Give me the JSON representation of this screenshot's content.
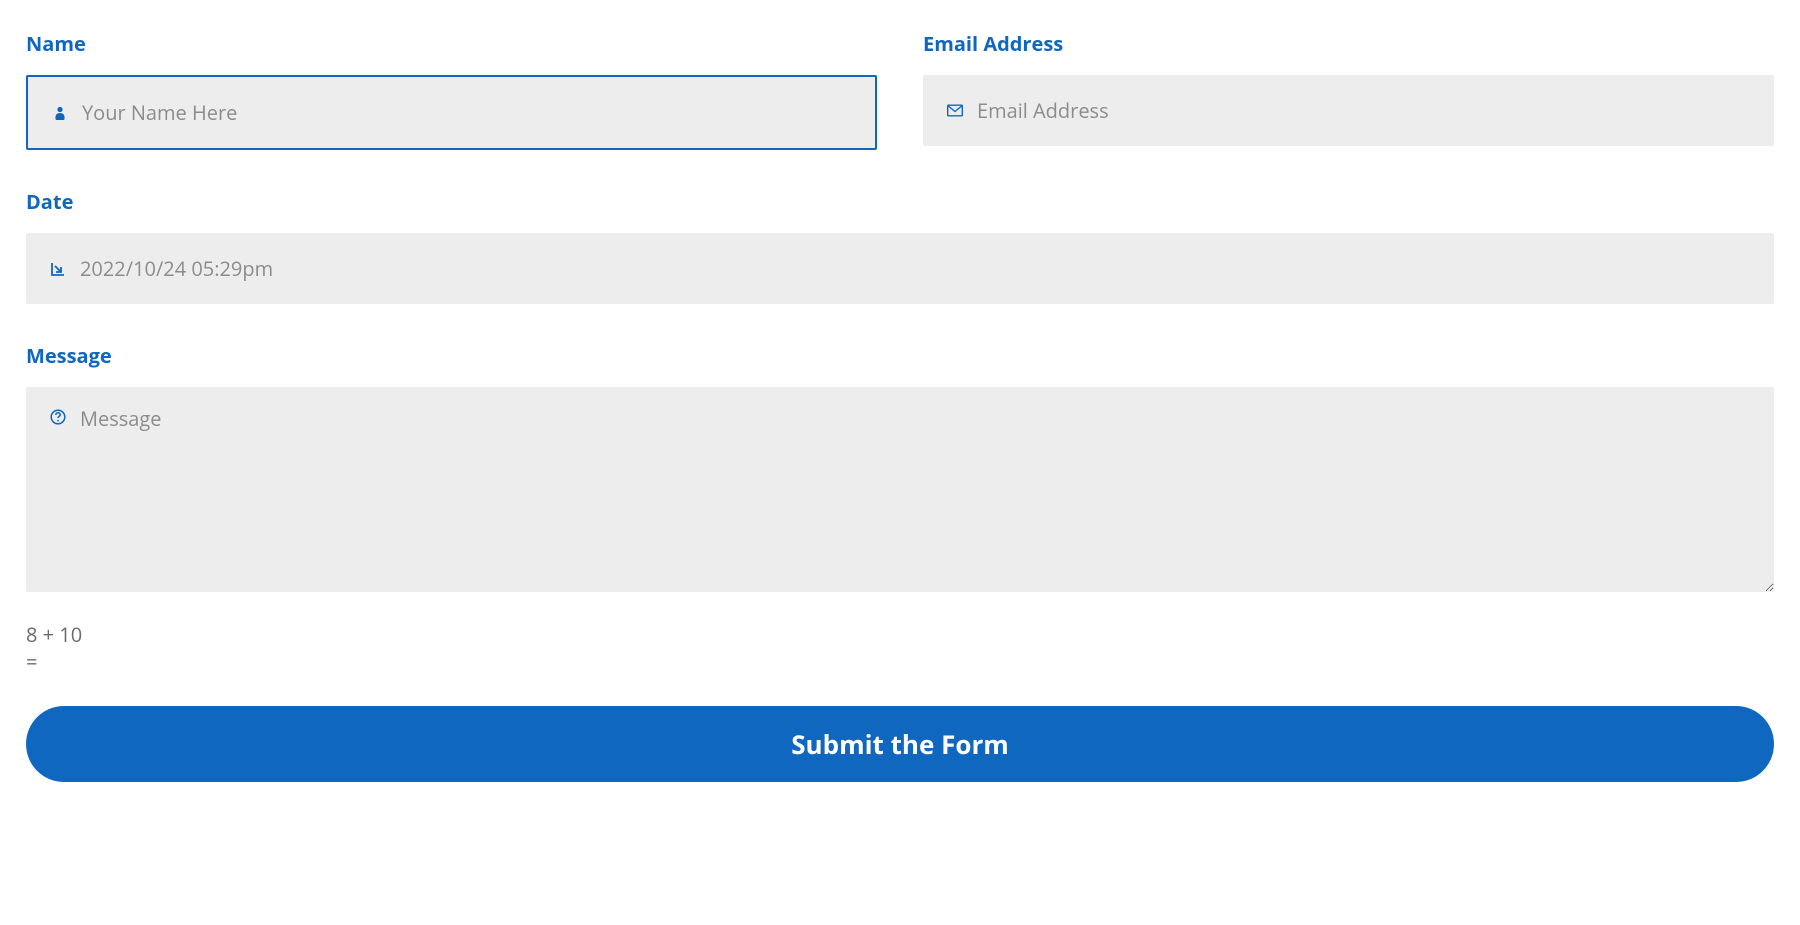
{
  "form": {
    "name": {
      "label": "Name",
      "placeholder": "Your Name Here",
      "value": ""
    },
    "email": {
      "label": "Email Address",
      "placeholder": "Email Address",
      "value": ""
    },
    "date": {
      "label": "Date",
      "placeholder": "2022/10/24 05:29pm",
      "value": ""
    },
    "message": {
      "label": "Message",
      "placeholder": "Message",
      "value": ""
    },
    "captcha": {
      "question": "8 + 10 =",
      "value": ""
    },
    "submit_label": "Submit the Form"
  },
  "colors": {
    "accent": "#0f67c0",
    "field_bg": "#ededed"
  }
}
